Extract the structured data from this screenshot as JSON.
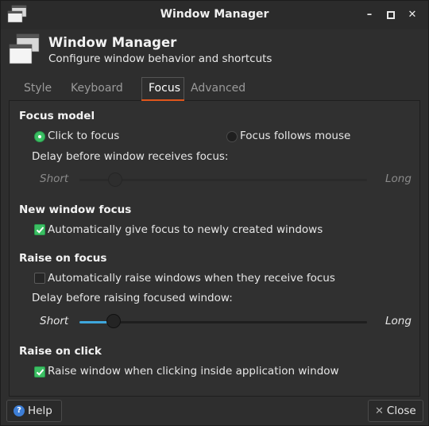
{
  "window": {
    "title": "Window Manager"
  },
  "header": {
    "title": "Window Manager",
    "subtitle": "Configure window behavior and shortcuts"
  },
  "tabs": [
    {
      "label": "Style",
      "active": false
    },
    {
      "label": "Keyboard",
      "active": false
    },
    {
      "label": "Focus",
      "active": true
    },
    {
      "label": "Advanced",
      "active": false
    }
  ],
  "focus_model": {
    "title": "Focus model",
    "option_click": "Click to focus",
    "option_follow": "Focus follows mouse",
    "selected": "Click to focus",
    "delay_label": "Delay before window receives focus:",
    "slider_min": "Short",
    "slider_max": "Long",
    "slider_value": 0.1,
    "slider_enabled": false
  },
  "new_window_focus": {
    "title": "New window focus",
    "checkbox_label": "Automatically give focus to newly created windows",
    "checked": true
  },
  "raise_on_focus": {
    "title": "Raise on focus",
    "checkbox_label": "Automatically raise windows when they receive focus",
    "checked": false,
    "delay_label": "Delay before raising focused window:",
    "slider_min": "Short",
    "slider_max": "Long",
    "slider_value": 0.12
  },
  "raise_on_click": {
    "title": "Raise on click",
    "checkbox_label": "Raise window when clicking inside application window",
    "checked": true
  },
  "footer": {
    "help_label": "Help",
    "close_label": "Close"
  },
  "colors": {
    "accent_green": "#3bbf63",
    "tab_underline": "#e0561b",
    "slider_fill": "#3ea7dc"
  }
}
